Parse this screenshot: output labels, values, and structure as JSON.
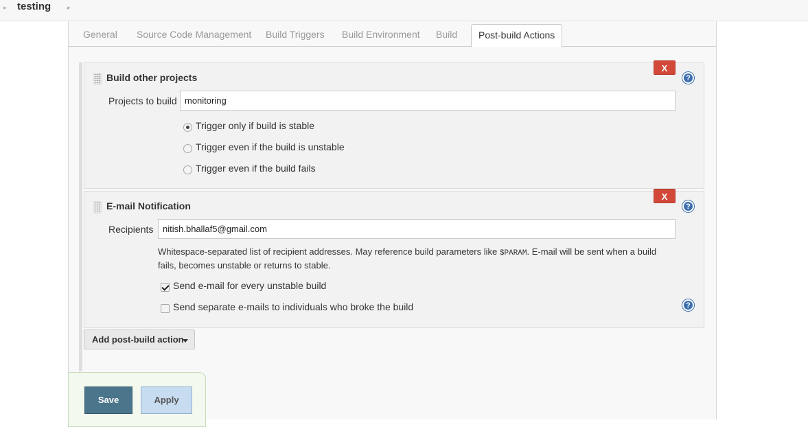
{
  "breadcrumb": {
    "title": "testing",
    "arrow": "▸"
  },
  "tabs": [
    {
      "label": "General"
    },
    {
      "label": "Source Code Management"
    },
    {
      "label": "Build Triggers"
    },
    {
      "label": "Build Environment"
    },
    {
      "label": "Build"
    },
    {
      "label": "Post-build Actions"
    }
  ],
  "build_other_projects": {
    "title": "Build other projects",
    "delete_label": "X",
    "help_glyph": "?",
    "projects_label": "Projects to build",
    "projects_value": "monitoring",
    "options": [
      {
        "label": "Trigger only if build is stable",
        "checked": true
      },
      {
        "label": "Trigger even if the build is unstable",
        "checked": false
      },
      {
        "label": "Trigger even if the build fails",
        "checked": false
      }
    ]
  },
  "email_notification": {
    "title": "E-mail Notification",
    "delete_label": "X",
    "help_glyph": "?",
    "recipients_label": "Recipients",
    "recipients_value": "nitish.bhallaf5@gmail.com",
    "description_part1": "Whitespace-separated list of recipient addresses. May reference build parameters like ",
    "description_code": "$PARAM",
    "description_part2": ". E-mail will be sent when a build fails, becomes unstable or returns to stable.",
    "checkbox_unstable": {
      "label": "Send e-mail for every unstable build",
      "checked": true
    },
    "checkbox_individuals": {
      "label": "Send separate e-mails to individuals who broke the build",
      "checked": false
    }
  },
  "add_action": {
    "label": "Add post-build action"
  },
  "buttons": {
    "save": "Save",
    "apply": "Apply"
  },
  "colors": {
    "delete": "#d24939",
    "help": "#3d6fb0",
    "save": "#4b758b",
    "apply": "#c7dcf0"
  }
}
